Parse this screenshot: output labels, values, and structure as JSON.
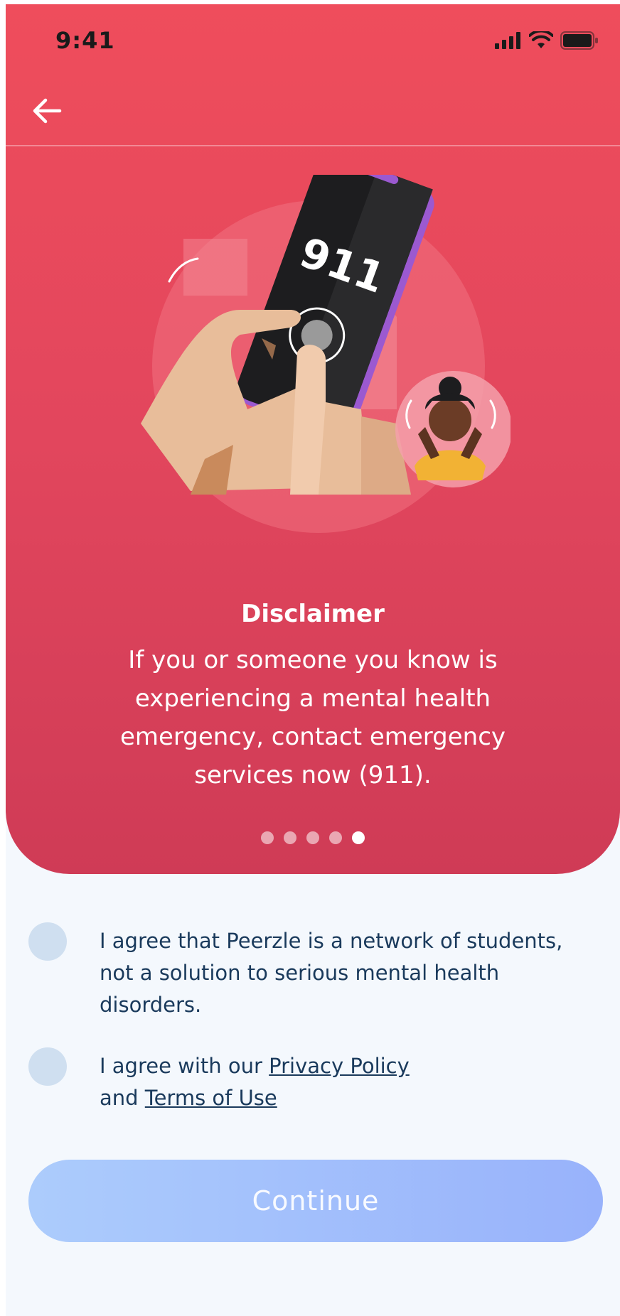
{
  "status_bar": {
    "time": "9:41"
  },
  "nav": {
    "back_icon": "arrow-left-icon"
  },
  "illustration": {
    "phone_number": "911"
  },
  "content": {
    "title": "Disclaimer",
    "description": "If you or someone you know is experiencing a mental health emergency, contact emergency services now (911)."
  },
  "pager": {
    "total": 5,
    "active_index": 4
  },
  "agreements": {
    "first": "I agree that Peerzle is a network of students, not a solution to serious mental health disorders.",
    "second_prefix": "I agree with our ",
    "privacy_policy": "Privacy Policy",
    "second_middle": "and ",
    "terms_of_use": "Terms of Use"
  },
  "continue_label": "Continue",
  "colors": {
    "hero_top": "#ef4d5c",
    "hero_bottom": "#cf3b56",
    "text_dark": "#1a3a5c",
    "button_start": "#acccfc",
    "button_end": "#98b2fb"
  }
}
